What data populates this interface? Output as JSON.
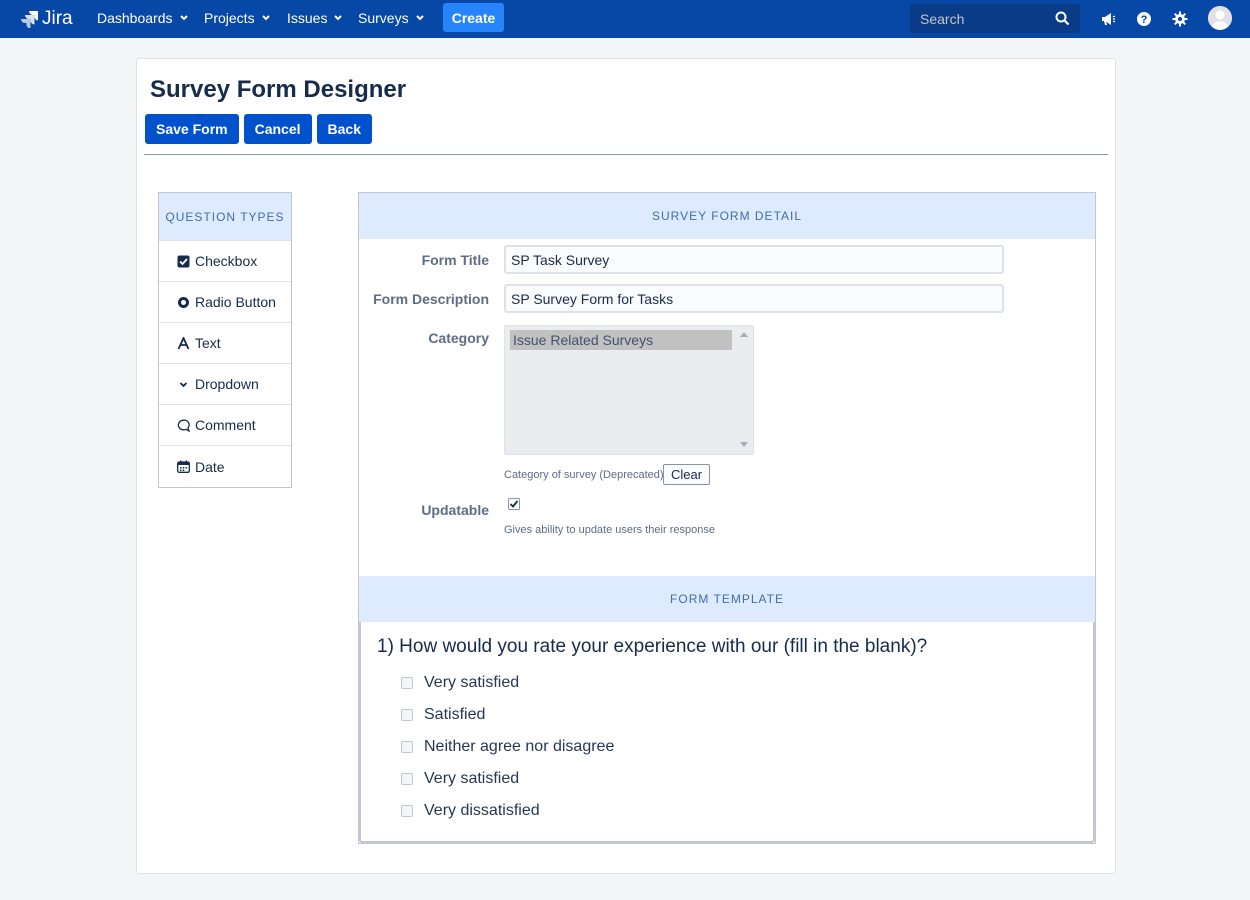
{
  "topbar": {
    "logo_text": "Jira",
    "nav": [
      {
        "label": "Dashboards"
      },
      {
        "label": "Projects"
      },
      {
        "label": "Issues"
      },
      {
        "label": "Surveys"
      }
    ],
    "create_label": "Create",
    "search_placeholder": "Search",
    "icons": [
      "megaphone-icon",
      "help-icon",
      "gear-icon",
      "avatar"
    ]
  },
  "page": {
    "title": "Survey Form Designer",
    "buttons": {
      "save": "Save Form",
      "cancel": "Cancel",
      "back": "Back"
    }
  },
  "question_types": {
    "header": "QUESTION TYPES",
    "items": [
      {
        "label": "Checkbox",
        "icon": "checkbox-icon"
      },
      {
        "label": "Radio Button",
        "icon": "radio-icon"
      },
      {
        "label": "Text",
        "icon": "text-icon"
      },
      {
        "label": "Dropdown",
        "icon": "chevron-down-icon"
      },
      {
        "label": "Comment",
        "icon": "comment-icon"
      },
      {
        "label": "Date",
        "icon": "calendar-icon"
      }
    ]
  },
  "detail": {
    "header": "SURVEY FORM DETAIL",
    "form_title_label": "Form Title",
    "form_title_value": "SP Task Survey",
    "form_desc_label": "Form Description",
    "form_desc_value": "SP Survey Form for Tasks",
    "category_label": "Category",
    "category_options": [
      "Issue Related Surveys"
    ],
    "category_help": "Category of survey (Deprecated)",
    "clear_label": "Clear",
    "updatable_label": "Updatable",
    "updatable_checked": true,
    "updatable_help": "Gives ability to update users their response"
  },
  "template": {
    "header": "FORM TEMPLATE",
    "question": "1) How would you rate your experience with our (fill in the blank)?",
    "answers": [
      "Very satisfied",
      "Satisfied",
      "Neither agree nor disagree",
      "Very satisfied",
      "Very dissatisfied"
    ]
  },
  "colors": {
    "topbar": "#0747a6",
    "primary_button": "#0052cc",
    "create_button": "#2684ff",
    "section_header": "#deebff"
  }
}
